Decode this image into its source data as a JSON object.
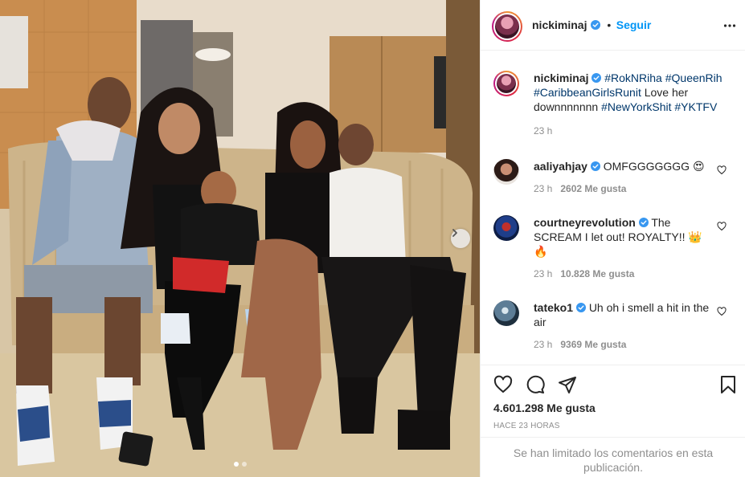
{
  "post": {
    "photo_description_icons": [
      "chevron-right-icon"
    ],
    "carousel": {
      "total": 2,
      "active_index": 0
    }
  },
  "header": {
    "username": "nickiminaj",
    "separator": "•",
    "follow_label": "Seguir"
  },
  "caption": {
    "username": "nickiminaj",
    "tags_line": "#RokNRiha #QueenRih #CaribbeanGirlsRunit",
    "text_a": "Love her downnnnnnn",
    "tags_b": "#NewYorkShit #YKTFV",
    "time": "23 h"
  },
  "comments": [
    {
      "username": "aaliyahjay",
      "text": "OMFGGGGGGG 😍",
      "time": "23 h",
      "likes": "2602 Me gusta"
    },
    {
      "username": "courtneyrevolution",
      "text": "The SCREAM I let out! ROYALTY!! 👑 🔥",
      "time": "23 h",
      "likes": "10.828 Me gusta"
    },
    {
      "username": "tateko1",
      "text": "Uh oh i smell a hit in the air",
      "time": "23 h",
      "likes": "9369 Me gusta"
    }
  ],
  "stats": {
    "likes": "4.601.298 Me gusta",
    "posted_ago": "HACE 23 HORAS"
  },
  "comments_limited": "Se han limitado los comentarios en esta publicación.",
  "colors": {
    "accent": "#0095f6",
    "verified": "#3897f0",
    "tag": "#00376b",
    "muted": "#8e8e8e"
  }
}
